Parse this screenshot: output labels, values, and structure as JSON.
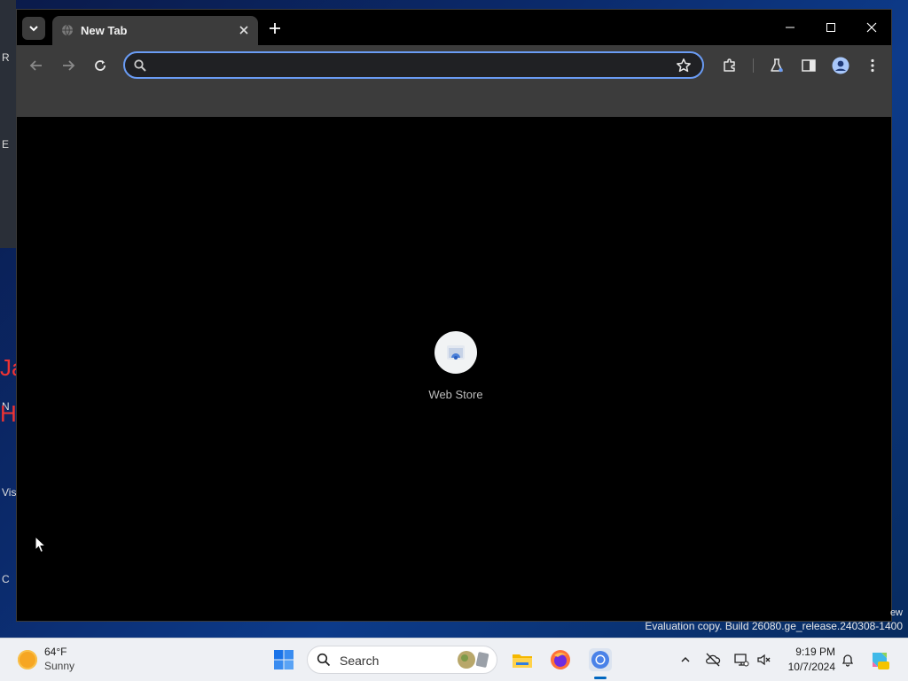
{
  "browser": {
    "tab": {
      "title": "New Tab"
    },
    "omnibox": {
      "value": "",
      "placeholder": ""
    },
    "accent_color": "#6a9cf5",
    "shortcuts": [
      {
        "label": "Web Store"
      }
    ]
  },
  "desktop": {
    "watermark": "Evaluation copy. Build 26080.ge_release.240308-1400",
    "watermark_fragment": "ew",
    "fragments": [
      "R",
      "E",
      "Ja",
      "N",
      "H",
      "Vis",
      "C"
    ]
  },
  "taskbar": {
    "weather": {
      "temp": "64°F",
      "condition": "Sunny"
    },
    "search_label": "Search",
    "clock": {
      "time": "9:19 PM",
      "date": "10/7/2024"
    }
  }
}
